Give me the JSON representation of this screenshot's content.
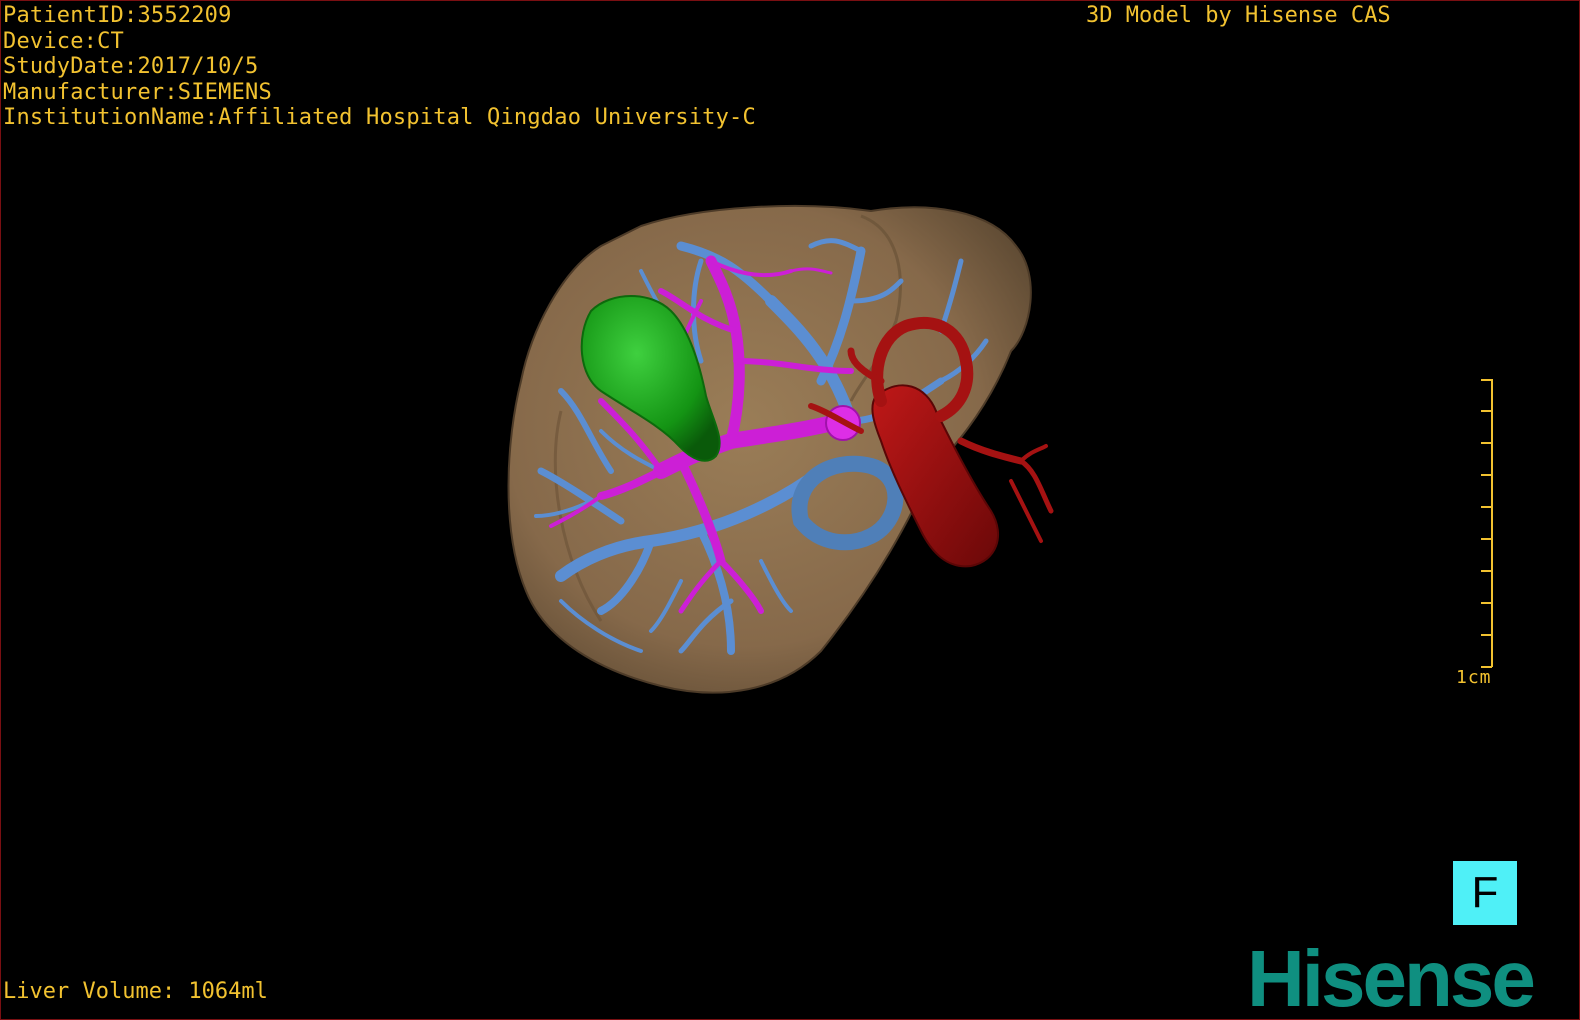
{
  "header": {
    "patient_id": "PatientID:3552209",
    "device": "Device:CT",
    "study_date": "StudyDate:2017/10/5",
    "manufacturer": "Manufacturer:SIEMENS",
    "institution": "InstitutionName:Affiliated Hospital Qingdao University-C"
  },
  "credit": "3D Model by Hisense CAS",
  "footer": {
    "liver_volume": "Liver Volume: 1064ml"
  },
  "scale_bar": {
    "label": "1cm",
    "color": "#f2c230"
  },
  "orientation_button": {
    "label": "F",
    "color": "#4ff0f7"
  },
  "logo": {
    "text": "Hisense",
    "color": "#0f8f80"
  },
  "model_colors": {
    "liver": "#8a6e4c",
    "gallbladder": "#1a9a1a",
    "portal_vein": "#cc1fd6",
    "hepatic_vein": "#5b8ed2",
    "inferior_vena_cava": "#9a1010",
    "background": "#000000",
    "frame": "#7a0f12"
  }
}
